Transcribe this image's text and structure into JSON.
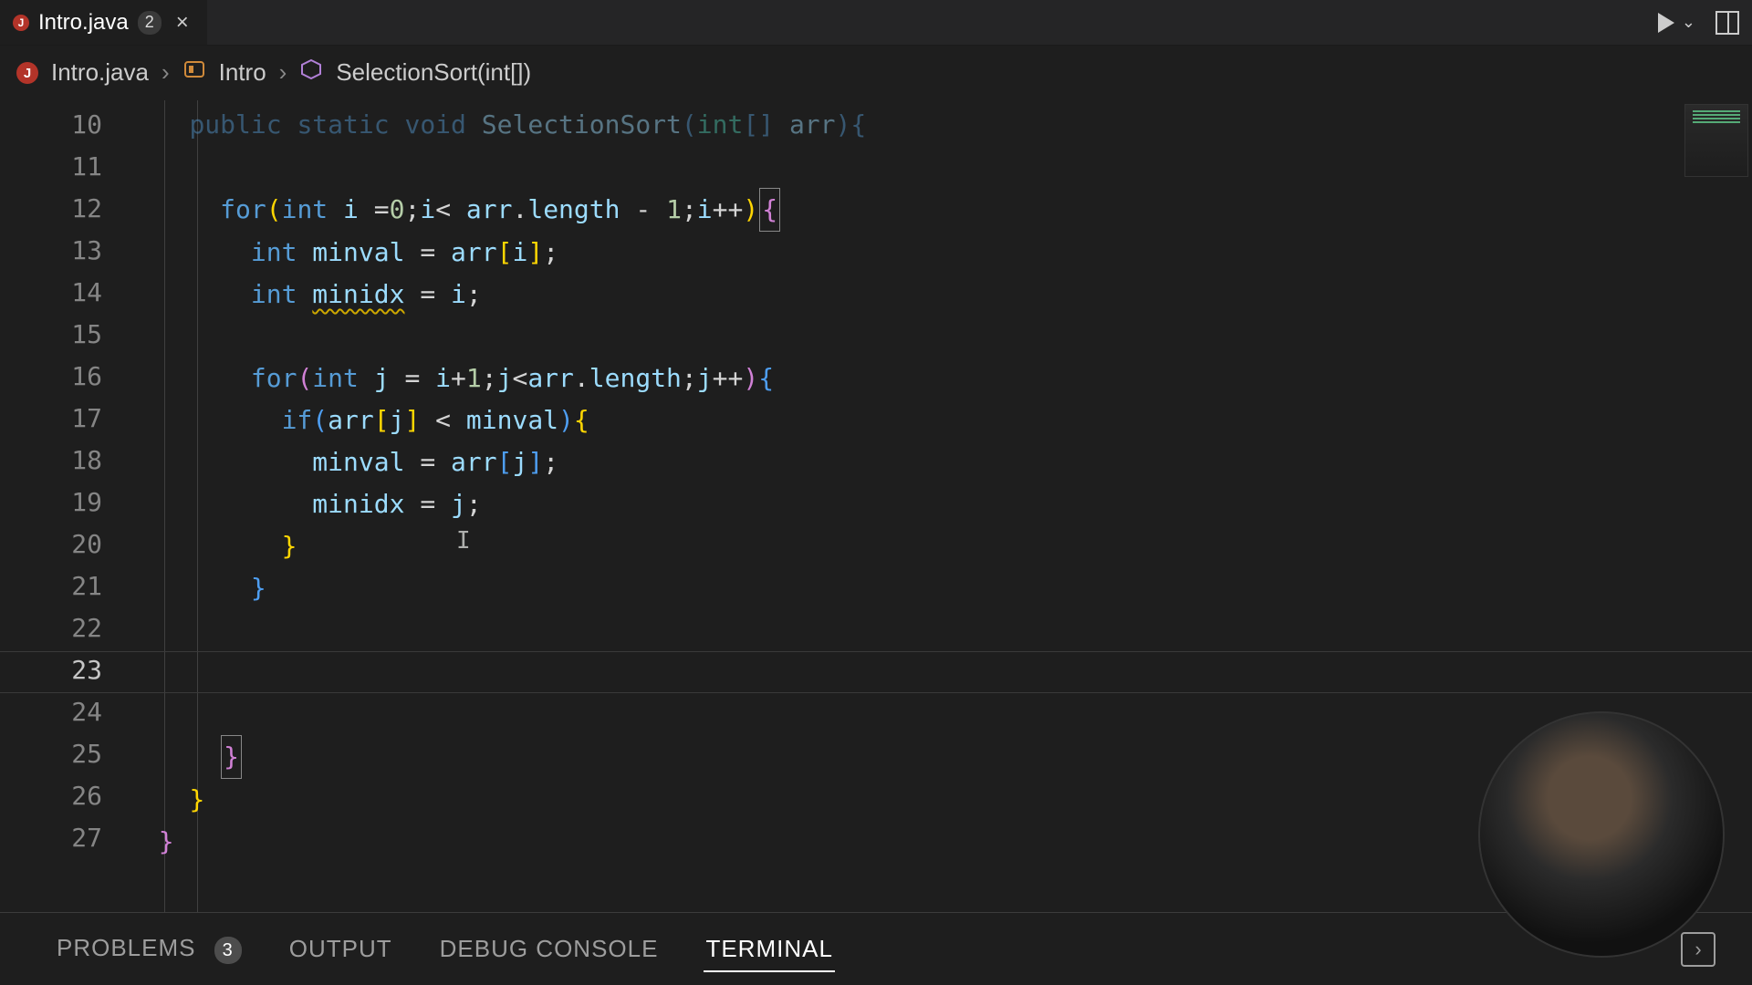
{
  "tab": {
    "filename": "Intro.java",
    "problem_count": "2",
    "close_glyph": "×"
  },
  "run": {
    "chevron": "⌄"
  },
  "breadcrumb": {
    "file": "Intro.java",
    "class": "Intro",
    "method": "SelectionSort(int[])",
    "sep": "›"
  },
  "code": {
    "lines": {
      "10": {
        "num": "10"
      },
      "11": {
        "num": "11"
      },
      "12": {
        "num": "12",
        "for": "for",
        "int": "int",
        "i": "i",
        "eq": "=",
        "zero": "0",
        "lt": "<",
        "arr": "arr",
        "dot": ".",
        "length": "length",
        "minus": "-",
        "one": "1",
        "ipp": "i++"
      },
      "13": {
        "num": "13",
        "int": "int",
        "minval": "minval",
        "eq": "=",
        "arr": "arr",
        "i": "i"
      },
      "14": {
        "num": "14",
        "int": "int",
        "minidx": "minidx",
        "eq": "=",
        "i": "i"
      },
      "15": {
        "num": "15"
      },
      "16": {
        "num": "16",
        "for": "for",
        "int": "int",
        "j": "j",
        "eq": "=",
        "i": "i",
        "plus": "+",
        "one": "1",
        "lt": "<",
        "arr": "arr",
        "dot": ".",
        "length": "length",
        "jpp": "j++"
      },
      "17": {
        "num": "17",
        "if": "if",
        "arr": "arr",
        "j": "j",
        "lt": "<",
        "minval": "minval"
      },
      "18": {
        "num": "18",
        "minval": "minval",
        "eq": "=",
        "arr": "arr",
        "j": "j"
      },
      "19": {
        "num": "19",
        "minidx": "minidx",
        "eq": "=",
        "j": "j"
      },
      "20": {
        "num": "20"
      },
      "21": {
        "num": "21"
      },
      "22": {
        "num": "22"
      },
      "23": {
        "num": "23"
      },
      "24": {
        "num": "24"
      },
      "25": {
        "num": "25"
      },
      "26": {
        "num": "26"
      },
      "27": {
        "num": "27"
      }
    },
    "signature": {
      "public": "public",
      "static": "static",
      "void": "void",
      "fn": "SelectionSort",
      "int": "int",
      "arr": "arr"
    },
    "braces": {
      "open": "{",
      "close": "}",
      "lpar": "(",
      "rpar": ")",
      "lbr": "[",
      "rbr": "]",
      "semi": ";"
    }
  },
  "panel": {
    "problems": "PROBLEMS",
    "problems_count": "3",
    "output": "OUTPUT",
    "debug": "DEBUG CONSOLE",
    "terminal": "TERMINAL",
    "more": "›"
  }
}
